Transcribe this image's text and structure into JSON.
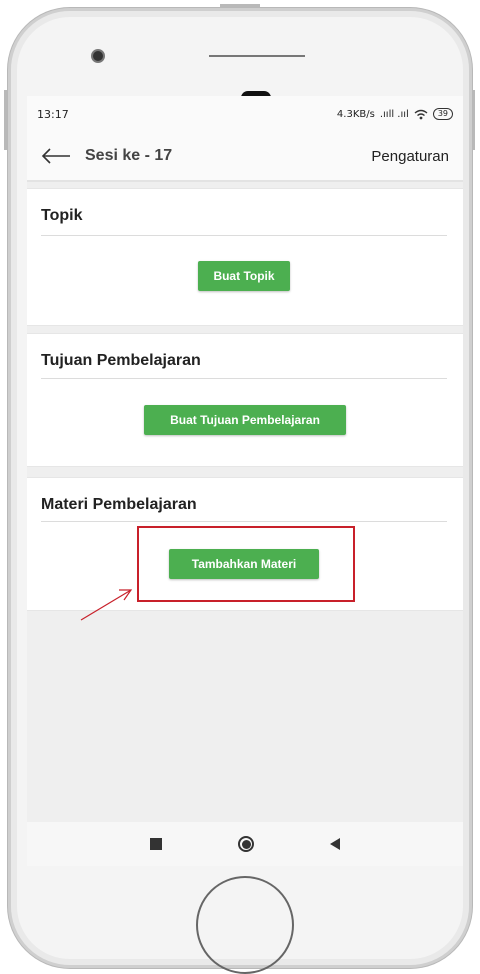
{
  "status_bar": {
    "time": "13:17",
    "network": "4.3KB/s",
    "signal_glyphs": ".ııll .ııl",
    "wifi_icon": "wifi-icon",
    "battery": "39"
  },
  "app_bar": {
    "back_icon": "arrow-left-icon",
    "title": "Sesi ke - 17",
    "settings_label": "Pengaturan"
  },
  "sections": [
    {
      "title": "Topik",
      "button_label": "Buat Topik"
    },
    {
      "title": "Tujuan Pembelajaran",
      "button_label": "Buat Tujuan Pembelajaran"
    },
    {
      "title": "Materi Pembelajaran",
      "button_label": "Tambahkan Materi"
    }
  ],
  "nav_bar": {
    "recent_icon": "square-icon",
    "home_icon": "circle-icon",
    "back_icon": "triangle-back-icon"
  },
  "colors": {
    "button_green": "#4caf50",
    "annotation_red": "#c8202a"
  }
}
